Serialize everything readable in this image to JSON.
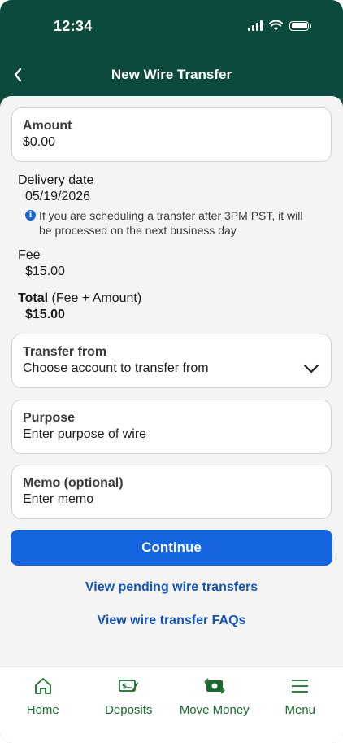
{
  "status_bar": {
    "time": "12:34"
  },
  "nav": {
    "title": "New Wire Transfer",
    "back_icon": "chevron-left-icon"
  },
  "form": {
    "amount": {
      "label": "Amount",
      "value": "$0.00"
    },
    "delivery": {
      "label": "Delivery date",
      "value": "05/19/2026",
      "note": "If you are scheduling a transfer after 3PM PST, it will be processed on the next business day."
    },
    "fee": {
      "label": "Fee",
      "value": "$15.00"
    },
    "total": {
      "label": "Total",
      "sublabel": "(Fee + Amount)",
      "value": "$15.00"
    },
    "transfer_from": {
      "label": "Transfer from",
      "placeholder": "Choose account to transfer from"
    },
    "purpose": {
      "label": "Purpose",
      "placeholder": "Enter purpose of wire"
    },
    "memo": {
      "label": "Memo (optional)",
      "placeholder": "Enter memo"
    }
  },
  "actions": {
    "continue_label": "Continue",
    "pending_link": "View pending wire transfers",
    "faq_link": "View wire transfer FAQs"
  },
  "tab_bar": {
    "items": [
      {
        "label": "Home",
        "icon": "home-icon"
      },
      {
        "label": "Deposits",
        "icon": "check-deposit-icon"
      },
      {
        "label": "Move Money",
        "icon": "money-transfer-icon"
      },
      {
        "label": "Menu",
        "icon": "hamburger-menu-icon"
      }
    ]
  },
  "colors": {
    "header": "#0d4a3e",
    "primary_button": "#1565e0",
    "link": "#1553b8",
    "tab_label": "#1b6b2e"
  }
}
